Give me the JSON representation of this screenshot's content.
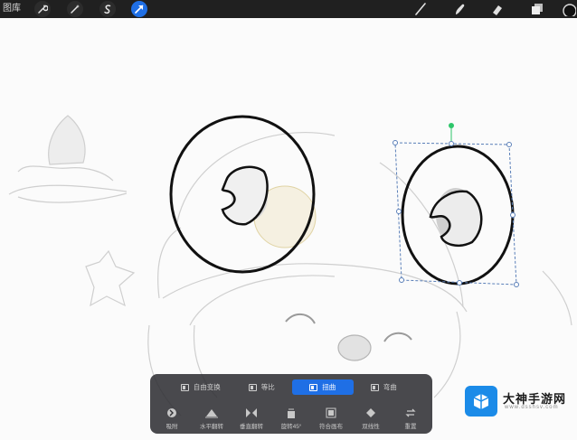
{
  "toolbar": {
    "gallery_label": "图库",
    "left_tools": [
      {
        "name": "actions",
        "icon": "wrench-icon"
      },
      {
        "name": "adjustments",
        "icon": "magic-wand-icon"
      },
      {
        "name": "selection",
        "icon": "selection-s-icon"
      },
      {
        "name": "transform",
        "icon": "transform-arrow-icon",
        "active": true
      }
    ],
    "right_tools": [
      {
        "name": "brush",
        "icon": "brush-icon"
      },
      {
        "name": "smudge",
        "icon": "smudge-icon"
      },
      {
        "name": "eraser",
        "icon": "eraser-icon"
      },
      {
        "name": "layers",
        "icon": "layers-icon"
      },
      {
        "name": "color",
        "icon": "color-swatch-icon"
      }
    ]
  },
  "transform_panel": {
    "modes": [
      {
        "label": "自由变换",
        "active": false
      },
      {
        "label": "等比",
        "active": false
      },
      {
        "label": "扭曲",
        "active": true
      },
      {
        "label": "弯曲",
        "active": false
      }
    ],
    "actions": [
      {
        "label": "吸附",
        "icon": "magnet-icon"
      },
      {
        "label": "水平翻转",
        "icon": "flip-horizontal-icon"
      },
      {
        "label": "垂直翻转",
        "icon": "flip-vertical-icon"
      },
      {
        "label": "旋转45°",
        "icon": "rotate-45-icon"
      },
      {
        "label": "符合画布",
        "icon": "fit-canvas-icon"
      },
      {
        "label": "双线性",
        "icon": "interpolation-icon"
      },
      {
        "label": "重置",
        "icon": "reset-icon"
      }
    ]
  },
  "watermark": {
    "title": "大神手游网",
    "url": "www.dsshsv.com"
  },
  "colors": {
    "toolbar_bg": "#202020",
    "accent": "#1f6fe5",
    "panel_bg": "#303034",
    "selection_handle": "#5a7fb8",
    "rotation_handle": "#2ec66a"
  }
}
